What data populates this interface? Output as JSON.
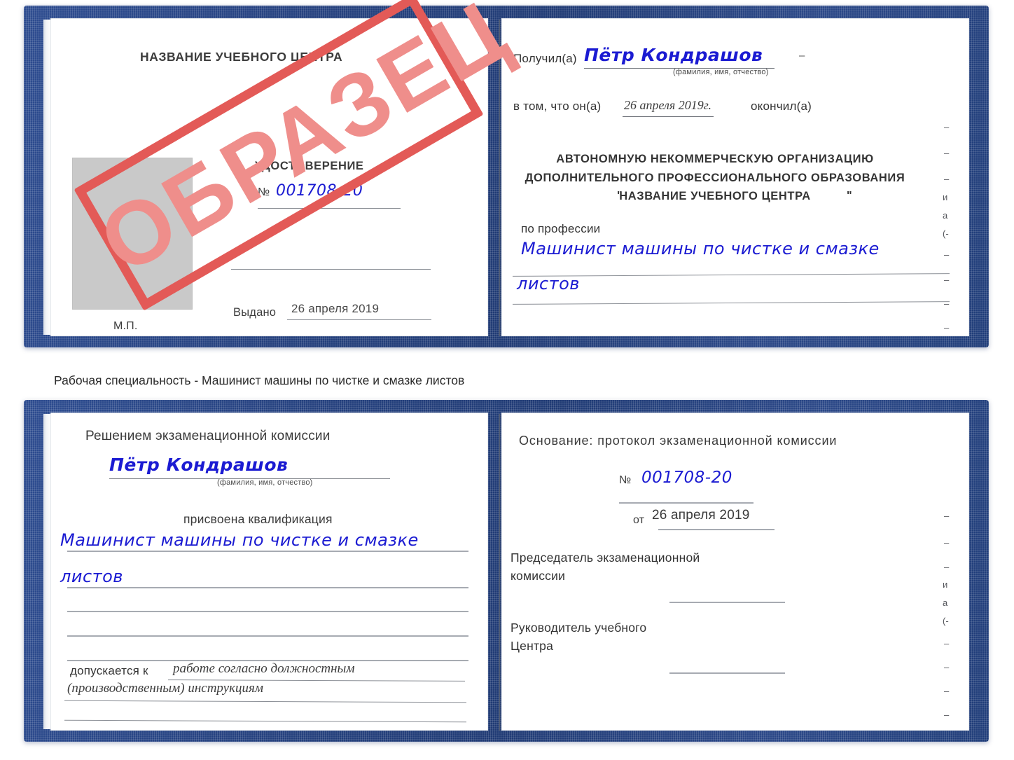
{
  "colors": {
    "cover_blue": "#24407e",
    "hand_blue": "#1b1bd2",
    "stamp_border_red": "#e35a57",
    "stamp_text_red": "#ef8e8b",
    "photo_gray": "#c9c9c9",
    "rule_gray": "#8b8f96"
  },
  "caption": "Рабочая специальность - Машинист машины по чистке и смазке листов",
  "stamp": {
    "text": "ОБРАЗЕЦ"
  },
  "certificate_top": {
    "left_page": {
      "org_title": "НАЗВАНИЕ УЧЕБНОГО ЦЕНТРА",
      "doc_type": "УДОСТОВЕРЕНИЕ",
      "number_label": "№",
      "number_value": "001708-20",
      "issued_label": "Выдано",
      "issued_value": "26 апреля 2019",
      "seal_label": "М.П."
    },
    "right_page": {
      "received_label": "Получил(а)",
      "received_value": "Пётр Кондрашов",
      "name_hint": "(фамилия, имя, отчество)",
      "in_that_label": "в том, что он(а)",
      "completion_date": "26 апреля 2019г.",
      "graduated_label": "окончил(а)",
      "org_line_1": "АВТОНОМНУЮ НЕКОММЕРЧЕСКУЮ ОРГАНИЗАЦИЮ",
      "org_line_2": "ДОПОЛНИТЕЛЬНОГО ПРОФЕССИОНАЛЬНОГО ОБРАЗОВАНИЯ",
      "org_quote_open": "\"",
      "org_line_3": "НАЗВАНИЕ УЧЕБНОГО ЦЕНТРА",
      "org_quote_close": "\"",
      "profession_label": "по профессии",
      "profession_value_1": "Машинист машины по чистке и смазке",
      "profession_value_2": "листов",
      "edge_peek": [
        "и",
        "а",
        "(-"
      ]
    }
  },
  "certificate_bottom": {
    "left_page": {
      "heading": "Решением экзаменационной комиссии",
      "name_value": "Пётр Кондрашов",
      "name_hint": "(фамилия, имя, отчество)",
      "qualification_label": "присвоена квалификация",
      "qualification_value_1": "Машинист машины по чистке и смазке",
      "qualification_value_2": "листов",
      "admitted_label": "допускается к",
      "admitted_value_1": "работе согласно должностным",
      "admitted_value_2": "(производственным) инструкциям"
    },
    "right_page": {
      "basis_label": "Основание: протокол экзаменационной комиссии",
      "number_label": "№",
      "number_value": "001708-20",
      "date_label": "от",
      "date_value": "26 апреля 2019",
      "chairman_line_1": "Председатель экзаменационной",
      "chairman_line_2": "комиссии",
      "head_line_1": "Руководитель учебного",
      "head_line_2": "Центра",
      "edge_peek": [
        "и",
        "а",
        "(-"
      ]
    }
  }
}
